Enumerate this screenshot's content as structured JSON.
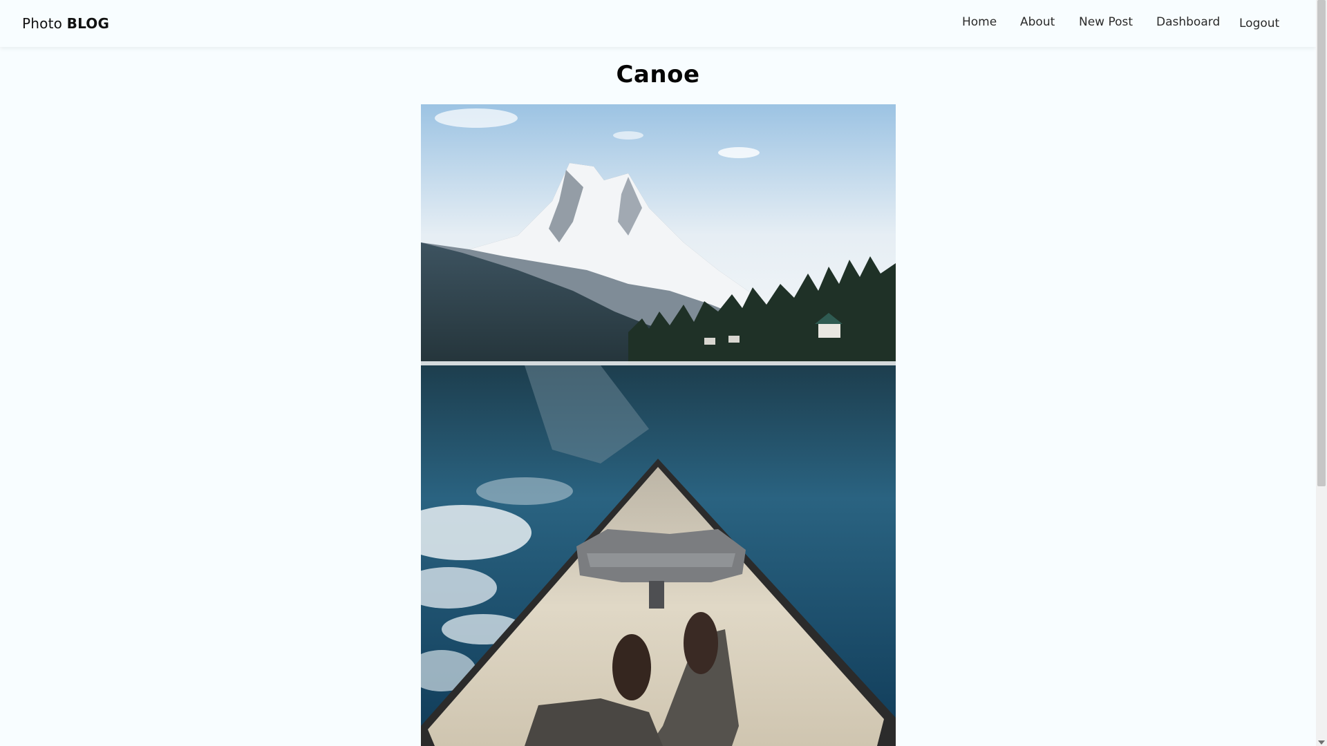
{
  "brand": {
    "light": "Photo",
    "bold": "BLOG"
  },
  "nav": {
    "home": "Home",
    "about": "About",
    "new_post": "New Post",
    "dashboard": "Dashboard",
    "logout": "Logout"
  },
  "post": {
    "title": "Canoe",
    "image": "canoe-lake-mountain-photo"
  },
  "colors": {
    "background": "#f8fdff",
    "text": "#050505"
  }
}
